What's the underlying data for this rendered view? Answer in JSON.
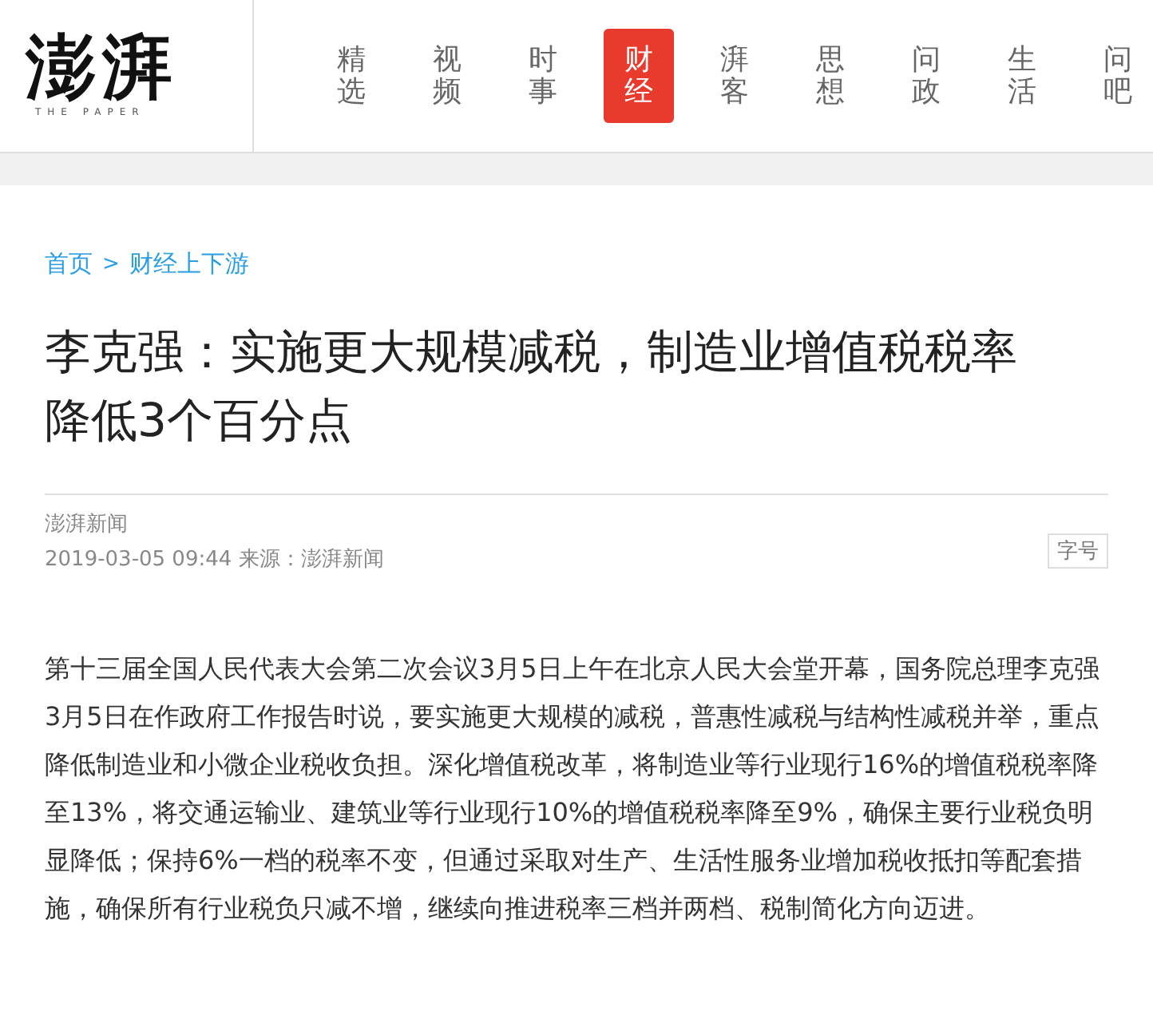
{
  "logo": {
    "name": "澎湃",
    "tagline": "THE PAPER"
  },
  "nav": [
    {
      "label": "精选",
      "selected": false
    },
    {
      "label": "视频",
      "selected": false
    },
    {
      "label": "时事",
      "selected": false
    },
    {
      "label": "财经",
      "selected": true
    },
    {
      "label": "湃客",
      "selected": false
    },
    {
      "label": "思想",
      "selected": false
    },
    {
      "label": "问政",
      "selected": false
    },
    {
      "label": "生活",
      "selected": false
    },
    {
      "label": "问吧",
      "selected": false
    }
  ],
  "breadcrumb": {
    "home": "首页",
    "separator": ">",
    "current": "财经上下游"
  },
  "article": {
    "title": "李克强：实施更大规模减税，制造业增值税税率降低3个百分点",
    "author": "澎湃新闻",
    "meta": "2019-03-05 09:44 来源：澎湃新闻",
    "font_size_button": "字号",
    "paragraphs": [
      "第十三届全国人民代表大会第二次会议3月5日上午在北京人民大会堂开幕，国务院总理李克强3月5日在作政府工作报告时说，要实施更大规模的减税，普惠性减税与结构性减税并举，重点降低制造业和小微企业税收负担。深化增值税改革，将制造业等行业现行16%的增值税税率降至13%，将交通运输业、建筑业等行业现行10%的增值税税率降至9%，确保主要行业税负明显降低；保持6%一档的税率不变，但通过采取对生产、生活性服务业增加税收抵扣等配套措施，确保所有行业税负只减不增，继续向推进税率三档并两档、税制简化方向迈进。"
    ]
  }
}
